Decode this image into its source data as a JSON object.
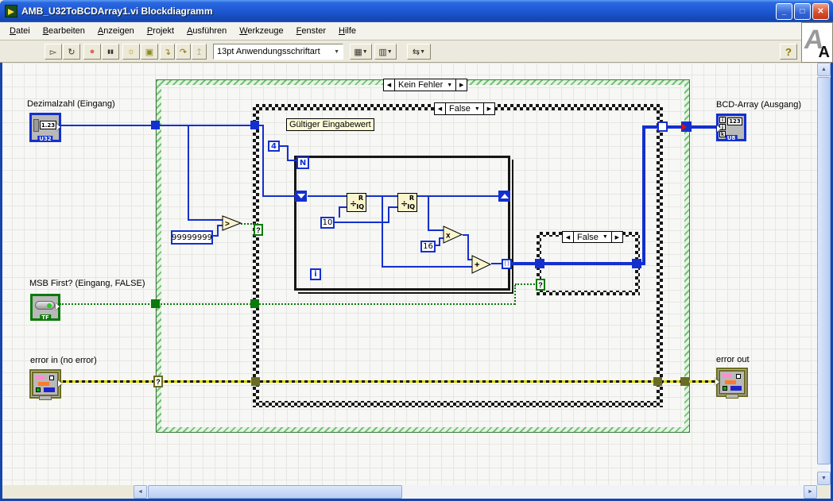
{
  "window": {
    "title": "AMB_U32ToBCDArray1.vi Blockdiagramm",
    "controls": {
      "minimize": "_",
      "maximize": "□",
      "close": "✕"
    }
  },
  "menu": {
    "items": [
      {
        "label": "Datei"
      },
      {
        "label": "Bearbeiten"
      },
      {
        "label": "Anzeigen"
      },
      {
        "label": "Projekt"
      },
      {
        "label": "Ausführen"
      },
      {
        "label": "Werkzeuge"
      },
      {
        "label": "Fenster"
      },
      {
        "label": "Hilfe"
      }
    ]
  },
  "toolbar": {
    "font_selector": "13pt Anwendungsschriftart",
    "dropdown_glyph": "▼",
    "help_label": "?",
    "buttons": [
      {
        "name": "run",
        "glyph": "▻"
      },
      {
        "name": "run-continuous",
        "glyph": "↻"
      },
      {
        "name": "abort",
        "glyph": "●"
      },
      {
        "name": "pause",
        "glyph": "▮▮"
      },
      {
        "name": "highlight-execution",
        "glyph": "☼"
      },
      {
        "name": "retain-wire-values",
        "glyph": "▣"
      },
      {
        "name": "step-into",
        "glyph": "↴"
      },
      {
        "name": "step-over",
        "glyph": "↷"
      },
      {
        "name": "step-out",
        "glyph": "↥"
      },
      {
        "name": "align-objects",
        "glyph": "▦"
      },
      {
        "name": "distribute-objects",
        "glyph": "▥"
      },
      {
        "name": "reorder",
        "glyph": "⇆"
      }
    ],
    "logo": {
      "back": "A",
      "front": "A"
    }
  },
  "diagram": {
    "outer_case": {
      "label": "Kein Fehler"
    },
    "inner_case": {
      "label": "False"
    },
    "reverse_case": {
      "label": "False"
    },
    "case_nav": {
      "prev": "◀",
      "menu": "▼",
      "next": "▶"
    },
    "comment": "Gültiger Eingabewert",
    "selector_glyph": "?",
    "array_glyph": "[]",
    "terminals": {
      "decimal": {
        "label": "Dezimalzahl (Eingang)",
        "value": "1.23",
        "type": "U32"
      },
      "bcd": {
        "label": "BCD-Array (Ausgang)",
        "value": "123",
        "type": "U8",
        "idx": [
          "i",
          "j",
          "k"
        ]
      },
      "msb": {
        "label": "MSB First? (Eingang, FALSE)",
        "type": "TF"
      },
      "error_in": {
        "label": "error in (no error)"
      },
      "error_out": {
        "label": "error out"
      }
    },
    "constants": {
      "digits": "4",
      "base": "10",
      "nibble": "16",
      "max": "99999999"
    },
    "loop": {
      "count": "N",
      "index": "i"
    },
    "nodes": {
      "qr_div": "÷",
      "qr_r": "R",
      "qr_iq": "IQ",
      "greater": ">",
      "multiply": "x",
      "add": "+"
    },
    "colors": {
      "numeric_wire": "#1330cf",
      "boolean_wire": "#0b7a0b",
      "error_wire": "#d6d600",
      "structure_green": "#74c274"
    }
  },
  "scrollbars": {
    "up": "▲",
    "down": "▼",
    "left": "◄",
    "right": "►"
  }
}
